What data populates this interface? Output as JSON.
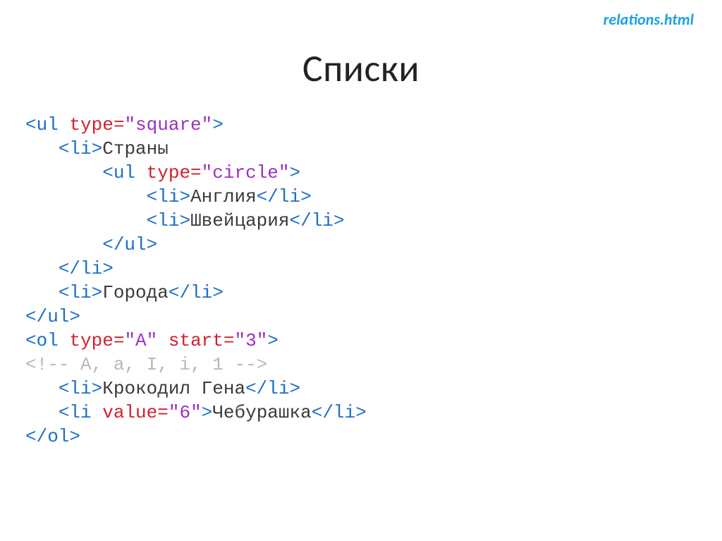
{
  "header": {
    "filename": "relations.html",
    "title": "Списки"
  },
  "code": {
    "l1": {
      "open": "<ul ",
      "attr": "type=",
      "val": "\"square\"",
      "close": ">"
    },
    "l2": {
      "open": "<li>",
      "text": "Страны"
    },
    "l3": {
      "open": "<ul ",
      "attr": "type=",
      "val": "\"circle\"",
      "close": ">"
    },
    "l4": {
      "open": "<li>",
      "text": "Англия",
      "close": "</li>"
    },
    "l5": {
      "open": "<li>",
      "text": "Швейцария",
      "close": "</li>"
    },
    "l6": {
      "close": "</ul>"
    },
    "l7": {
      "close": "</li>"
    },
    "l8": {
      "open": "<li>",
      "text": "Города",
      "close": "</li>"
    },
    "l9": {
      "close": "</ul>"
    },
    "l10": {
      "open": "<ol ",
      "attr1": "type=",
      "val1": "\"A\" ",
      "attr2": "start=",
      "val2": "\"3\"",
      "close": ">"
    },
    "l11": {
      "comment": "<!-- A, a, I, i, 1 -->"
    },
    "l12": {
      "open": "<li>",
      "text": "Крокодил Гена",
      "close": "</li>"
    },
    "l13": {
      "open": "<li ",
      "attr": "value=",
      "val": "\"6\"",
      "mid": ">",
      "text": "Чебурашка",
      "close": "</li>"
    },
    "l14": {
      "close": "</ol>"
    }
  }
}
